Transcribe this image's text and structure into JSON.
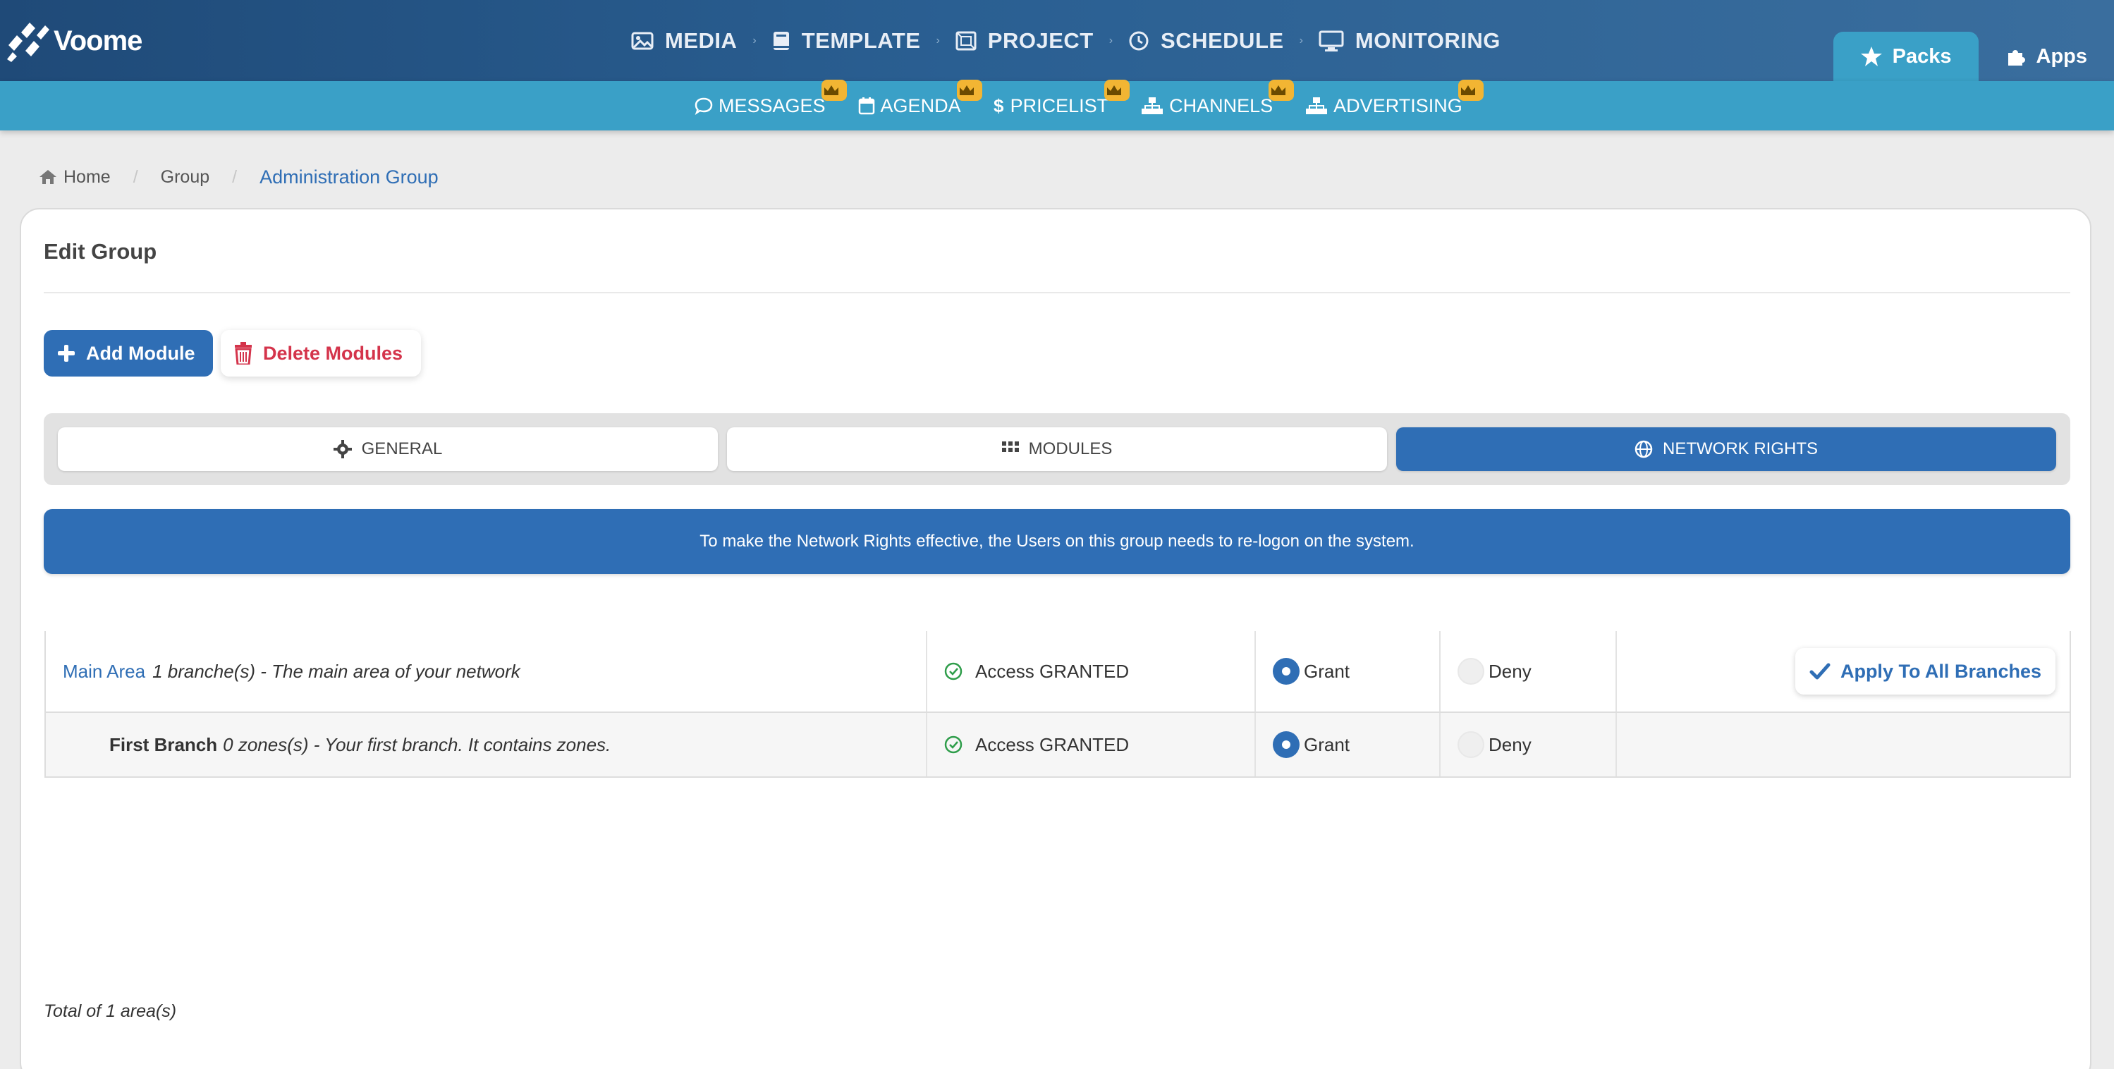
{
  "app": {
    "logo_text": "Voome"
  },
  "main_nav": [
    {
      "label": "MEDIA",
      "icon": "image-icon"
    },
    {
      "label": "TEMPLATE",
      "icon": "book-icon"
    },
    {
      "label": "PROJECT",
      "icon": "project-icon"
    },
    {
      "label": "SCHEDULE",
      "icon": "clock-icon"
    },
    {
      "label": "MONITORING",
      "icon": "monitor-icon"
    }
  ],
  "top_tabs": {
    "packs": "Packs",
    "apps": "Apps"
  },
  "sub_nav": [
    {
      "label": "MESSAGES",
      "icon": "chat-icon"
    },
    {
      "label": "AGENDA",
      "icon": "calendar-icon"
    },
    {
      "label": "PRICELIST",
      "icon": "dollar-icon"
    },
    {
      "label": "CHANNELS",
      "icon": "sitemap-icon"
    },
    {
      "label": "ADVERTISING",
      "icon": "sitemap-icon"
    }
  ],
  "breadcrumb": {
    "home": "Home",
    "group": "Group",
    "current": "Administration Group"
  },
  "card": {
    "title": "Edit Group",
    "add_module": "Add Module",
    "delete_modules": "Delete Modules"
  },
  "tabs": {
    "general": "GENERAL",
    "modules": "MODULES",
    "network_rights": "NETWORK RIGHTS"
  },
  "alert": "To make the Network Rights effective, the Users on this group needs to re-logon on the system.",
  "rows": [
    {
      "name": "Main Area",
      "desc": "1 branche(s) - The main area of your network",
      "access": "Access GRANTED",
      "grant": "Grant",
      "deny": "Deny",
      "apply": "Apply To All Branches"
    },
    {
      "name": "First Branch",
      "desc": "0 zones(s) - Your first branch. It contains zones.",
      "access": "Access GRANTED",
      "grant": "Grant",
      "deny": "Deny"
    }
  ],
  "total": "Total of 1 area(s)",
  "colors": {
    "primary": "#2f6eb5",
    "subbar": "#3aa0c7",
    "danger": "#d4344b",
    "crown": "#f2b533",
    "success": "#2e9d4a"
  }
}
